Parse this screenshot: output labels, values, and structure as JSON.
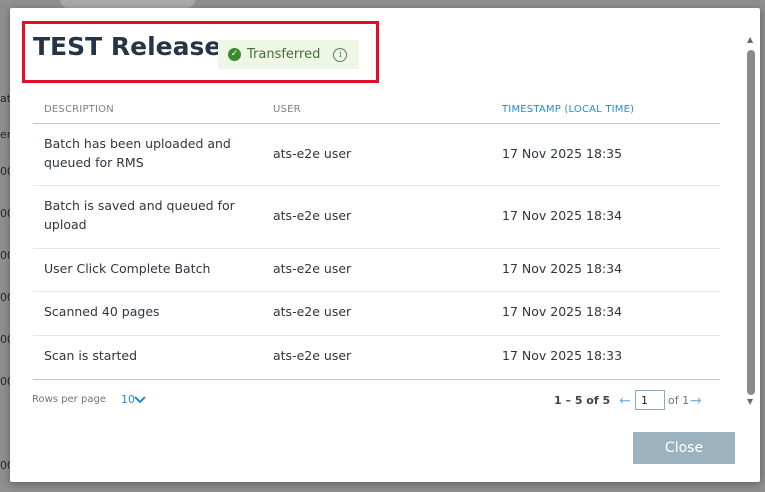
{
  "modal": {
    "title": "TEST Release",
    "status_badge": {
      "label": "Transferred",
      "icon": "check-circle-icon",
      "info_icon": "info-icon"
    },
    "table": {
      "columns": [
        "DESCRIPTION",
        "USER",
        "TIMESTAMP (LOCAL TIME)"
      ],
      "active_sort_column": "TIMESTAMP (LOCAL TIME)",
      "rows": [
        {
          "description": "Batch has been uploaded and queued for RMS",
          "user": "ats-e2e user",
          "timestamp": "17 Nov 2025 18:35"
        },
        {
          "description": "Batch is saved and queued for upload",
          "user": "ats-e2e user",
          "timestamp": "17 Nov 2025 18:34"
        },
        {
          "description": "User Click Complete Batch",
          "user": "ats-e2e user",
          "timestamp": "17 Nov 2025 18:34"
        },
        {
          "description": "Scanned 40 pages",
          "user": "ats-e2e user",
          "timestamp": "17 Nov 2025 18:34"
        },
        {
          "description": "Scan is started",
          "user": "ats-e2e user",
          "timestamp": "17 Nov 2025 18:33"
        }
      ]
    },
    "pagination": {
      "rows_per_page_label": "Rows per page",
      "rows_per_page_value": "10",
      "range": "1 – 5 of 5",
      "current_page": "1",
      "of_pages": "of 1"
    },
    "close_label": "Close"
  },
  "colors": {
    "accent": "#2a8bd0",
    "badge_bg": "#eef7e6",
    "badge_check": "#3a8a2f",
    "highlight_border": "#e0102a",
    "close_button": "#9db2bf"
  },
  "background": {
    "partial_texts": [
      "atch",
      "er",
      "00",
      "00",
      "00",
      "00",
      "00",
      "00",
      "00"
    ]
  }
}
